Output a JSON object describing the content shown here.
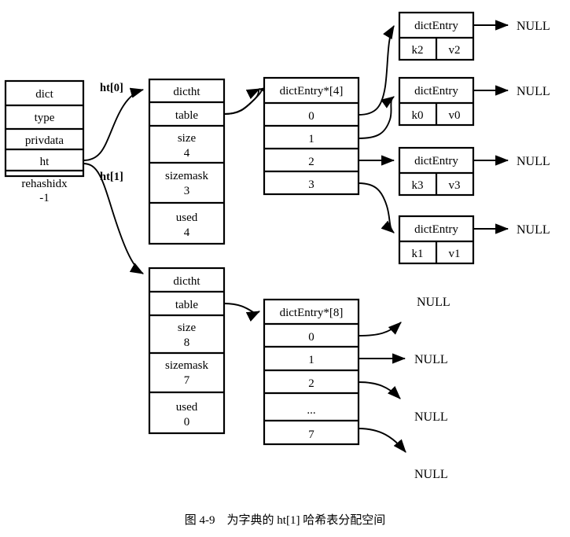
{
  "figure": {
    "caption": "图 4-9    为字典的 ht[1] 哈希表分配空间",
    "null_label": "NULL"
  },
  "dict_struct": {
    "title": "dict",
    "fields": [
      {
        "name": "type",
        "value": ""
      },
      {
        "name": "privdata",
        "value": ""
      },
      {
        "name": "ht",
        "value": ""
      },
      {
        "name": "rehashidx",
        "value": "-1"
      }
    ]
  },
  "edges": {
    "ht0_label": "ht[0]",
    "ht1_label": "ht[1]"
  },
  "hashtables": [
    {
      "id": "ht0",
      "title": "dictht",
      "table_field": "table",
      "fields": [
        {
          "name": "size",
          "value": "4"
        },
        {
          "name": "sizemask",
          "value": "3"
        },
        {
          "name": "used",
          "value": "4"
        }
      ],
      "bucket_array": {
        "title": "dictEntry*[4]",
        "indexes": [
          "0",
          "1",
          "2",
          "3"
        ]
      }
    },
    {
      "id": "ht1",
      "title": "dictht",
      "table_field": "table",
      "fields": [
        {
          "name": "size",
          "value": "8"
        },
        {
          "name": "sizemask",
          "value": "7"
        },
        {
          "name": "used",
          "value": "0"
        }
      ],
      "bucket_array": {
        "title": "dictEntry*[8]",
        "indexes": [
          "0",
          "1",
          "2",
          "...",
          "7"
        ]
      }
    }
  ],
  "entries": [
    {
      "title": "dictEntry",
      "key": "k2",
      "value": "v2",
      "next": "NULL"
    },
    {
      "title": "dictEntry",
      "key": "k0",
      "value": "v0",
      "next": "NULL"
    },
    {
      "title": "dictEntry",
      "key": "k3",
      "value": "v3",
      "next": "NULL"
    },
    {
      "title": "dictEntry",
      "key": "k1",
      "value": "v1",
      "next": "NULL"
    }
  ],
  "ht1_nulls": [
    "NULL",
    "NULL",
    "NULL",
    "NULL"
  ],
  "colors": {
    "stroke": "#000000",
    "fill": "#ffffff",
    "text": "#000000"
  }
}
